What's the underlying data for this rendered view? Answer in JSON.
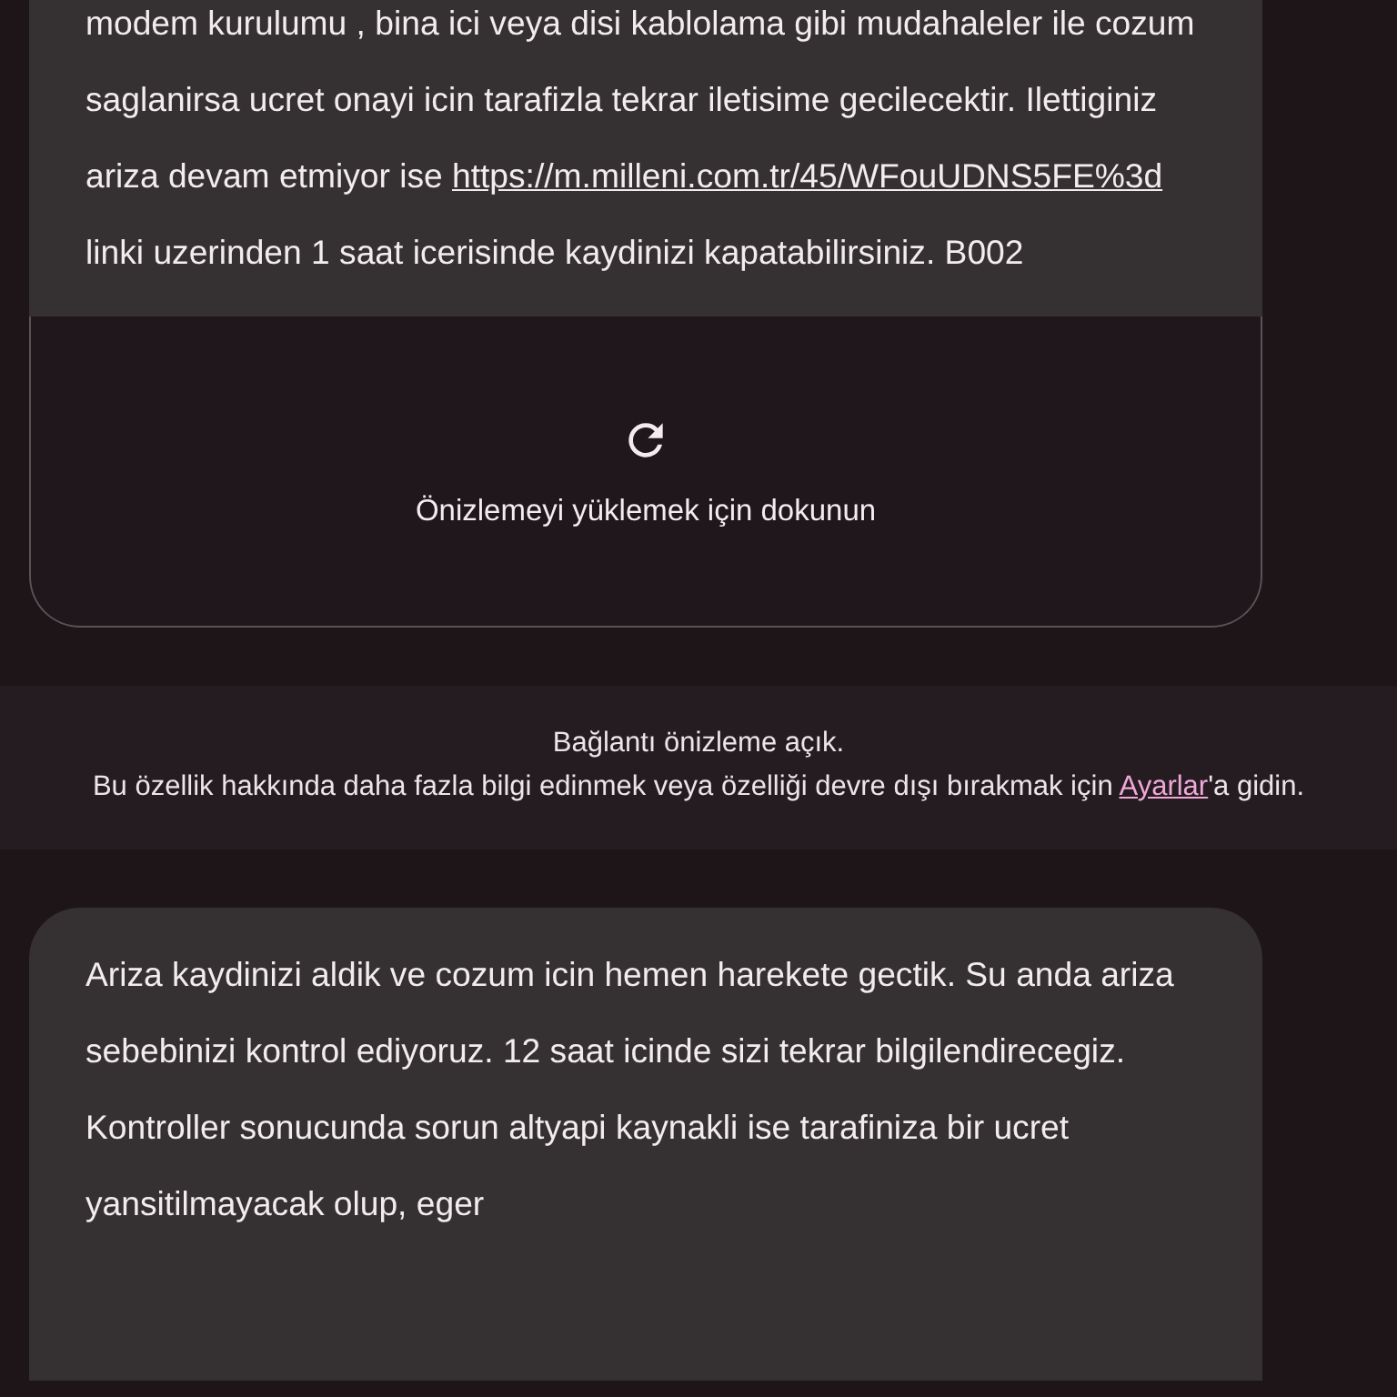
{
  "messages": [
    {
      "text_before": "modem kurulumu , bina ici veya disi kablolama gibi mudahaleler ile cozum saglanirsa ucret onayi icin tarafizla tekrar iletisime gecilecektir. Ilettiginiz ariza devam etmiyor ise ",
      "link": "https://m.milleni.com.tr/45/WFouUDNS5FE%3d",
      "text_after": " linki uzerinden 1 saat icerisinde kaydinizi kapatabilirsiniz. B002",
      "preview": {
        "label": "Önizlemeyi yüklemek için dokunun"
      }
    },
    {
      "text_before": "Ariza kaydinizi aldik ve cozum icin hemen harekete gectik. Su anda ariza sebebinizi kontrol ediyoruz. 12 saat icinde sizi tekrar bilgilendirecegiz. Kontroller sonucunda sorun altyapi kaynakli ise tarafiniza bir ucret yansitilmayacak olup, eger"
    }
  ],
  "notice": {
    "title": "Bağlantı önizleme açık.",
    "text_before": "Bu özellik hakkında daha fazla bilgi edinmek veya özelliği devre dışı bırakmak için ",
    "link": "Ayarlar",
    "text_after": "'a gidin."
  }
}
